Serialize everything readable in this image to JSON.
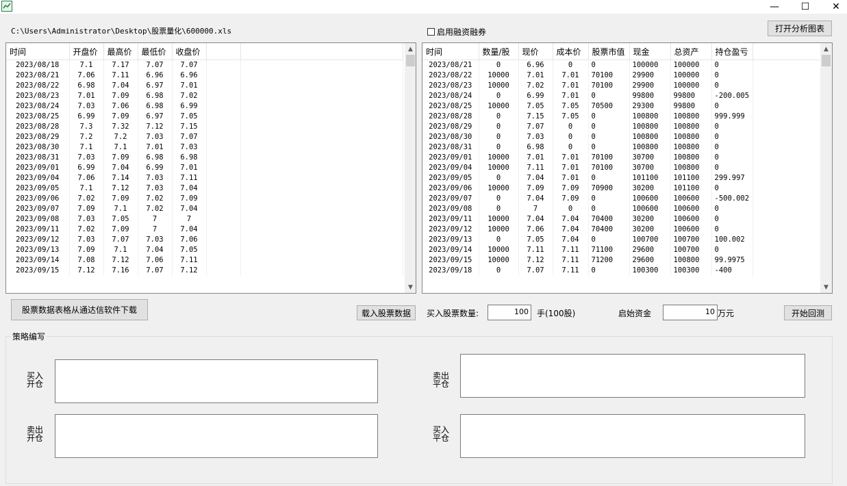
{
  "window": {
    "controls": [
      "—",
      "☐",
      "✕"
    ]
  },
  "file_path": "C:\\Users\\Administrator\\Desktop\\股票量化\\600000.xls",
  "margin_checkbox": {
    "label": "启用融资融券",
    "checked": false
  },
  "open_chart_button": "打开分析图表",
  "price_table": {
    "columns": [
      "时间",
      "开盘价",
      "最高价",
      "最低价",
      "收盘价"
    ],
    "rows": [
      [
        "2023/08/18",
        "7.1",
        "7.17",
        "7.07",
        "7.07"
      ],
      [
        "2023/08/21",
        "7.06",
        "7.11",
        "6.96",
        "6.96"
      ],
      [
        "2023/08/22",
        "6.98",
        "7.04",
        "6.97",
        "7.01"
      ],
      [
        "2023/08/23",
        "7.01",
        "7.09",
        "6.98",
        "7.02"
      ],
      [
        "2023/08/24",
        "7.03",
        "7.06",
        "6.98",
        "6.99"
      ],
      [
        "2023/08/25",
        "6.99",
        "7.09",
        "6.97",
        "7.05"
      ],
      [
        "2023/08/28",
        "7.3",
        "7.32",
        "7.12",
        "7.15"
      ],
      [
        "2023/08/29",
        "7.2",
        "7.2",
        "7.03",
        "7.07"
      ],
      [
        "2023/08/30",
        "7.1",
        "7.1",
        "7.01",
        "7.03"
      ],
      [
        "2023/08/31",
        "7.03",
        "7.09",
        "6.98",
        "6.98"
      ],
      [
        "2023/09/01",
        "6.99",
        "7.04",
        "6.99",
        "7.01"
      ],
      [
        "2023/09/04",
        "7.06",
        "7.14",
        "7.03",
        "7.11"
      ],
      [
        "2023/09/05",
        "7.1",
        "7.12",
        "7.03",
        "7.04"
      ],
      [
        "2023/09/06",
        "7.02",
        "7.09",
        "7.02",
        "7.09"
      ],
      [
        "2023/09/07",
        "7.09",
        "7.1",
        "7.02",
        "7.04"
      ],
      [
        "2023/09/08",
        "7.03",
        "7.05",
        "7",
        "7"
      ],
      [
        "2023/09/11",
        "7.02",
        "7.09",
        "7",
        "7.04"
      ],
      [
        "2023/09/12",
        "7.03",
        "7.07",
        "7.03",
        "7.06"
      ],
      [
        "2023/09/13",
        "7.09",
        "7.1",
        "7.04",
        "7.05"
      ],
      [
        "2023/09/14",
        "7.08",
        "7.12",
        "7.06",
        "7.11"
      ],
      [
        "2023/09/15",
        "7.12",
        "7.16",
        "7.07",
        "7.12"
      ]
    ]
  },
  "backtest_table": {
    "columns": [
      "时间",
      "数量/股",
      "现价",
      "成本价",
      "股票市值",
      "现金",
      "总资产",
      "持仓盈亏"
    ],
    "rows": [
      [
        "2023/08/21",
        "0",
        "6.96",
        "0",
        "0",
        "100000",
        "100000",
        "0"
      ],
      [
        "2023/08/22",
        "10000",
        "7.01",
        "7.01",
        "70100",
        "29900",
        "100000",
        "0"
      ],
      [
        "2023/08/23",
        "10000",
        "7.02",
        "7.01",
        "70100",
        "29900",
        "100000",
        "0"
      ],
      [
        "2023/08/24",
        "0",
        "6.99",
        "7.01",
        "0",
        "99800",
        "99800",
        "-200.005"
      ],
      [
        "2023/08/25",
        "10000",
        "7.05",
        "7.05",
        "70500",
        "29300",
        "99800",
        "0"
      ],
      [
        "2023/08/28",
        "0",
        "7.15",
        "7.05",
        "0",
        "100800",
        "100800",
        "999.999"
      ],
      [
        "2023/08/29",
        "0",
        "7.07",
        "0",
        "0",
        "100800",
        "100800",
        "0"
      ],
      [
        "2023/08/30",
        "0",
        "7.03",
        "0",
        "0",
        "100800",
        "100800",
        "0"
      ],
      [
        "2023/08/31",
        "0",
        "6.98",
        "0",
        "0",
        "100800",
        "100800",
        "0"
      ],
      [
        "2023/09/01",
        "10000",
        "7.01",
        "7.01",
        "70100",
        "30700",
        "100800",
        "0"
      ],
      [
        "2023/09/04",
        "10000",
        "7.11",
        "7.01",
        "70100",
        "30700",
        "100800",
        "0"
      ],
      [
        "2023/09/05",
        "0",
        "7.04",
        "7.01",
        "0",
        "101100",
        "101100",
        "299.997"
      ],
      [
        "2023/09/06",
        "10000",
        "7.09",
        "7.09",
        "70900",
        "30200",
        "101100",
        "0"
      ],
      [
        "2023/09/07",
        "0",
        "7.04",
        "7.09",
        "0",
        "100600",
        "100600",
        "-500.002"
      ],
      [
        "2023/09/08",
        "0",
        "7",
        "0",
        "0",
        "100600",
        "100600",
        "0"
      ],
      [
        "2023/09/11",
        "10000",
        "7.04",
        "7.04",
        "70400",
        "30200",
        "100600",
        "0"
      ],
      [
        "2023/09/12",
        "10000",
        "7.06",
        "7.04",
        "70400",
        "30200",
        "100600",
        "0"
      ],
      [
        "2023/09/13",
        "0",
        "7.05",
        "7.04",
        "0",
        "100700",
        "100700",
        "100.002"
      ],
      [
        "2023/09/14",
        "10000",
        "7.11",
        "7.11",
        "71100",
        "29600",
        "100700",
        "0"
      ],
      [
        "2023/09/15",
        "10000",
        "7.12",
        "7.11",
        "71200",
        "29600",
        "100800",
        "99.9975"
      ],
      [
        "2023/09/18",
        "0",
        "7.07",
        "7.11",
        "0",
        "100300",
        "100300",
        "-400"
      ]
    ]
  },
  "download_button": "股票数据表格从通达信软件下载",
  "load_button": "载入股票数据",
  "buy_qty": {
    "label": "买入股票数量:",
    "value": "100",
    "unit": "手(100股)"
  },
  "capital": {
    "label": "启始资金",
    "value": "10",
    "unit": "万元"
  },
  "start_backtest_button": "开始回测",
  "strategy": {
    "group_label": "策略编写",
    "buy_open": [
      "买入",
      "开仓"
    ],
    "sell_close": [
      "卖出",
      "平仓"
    ],
    "sell_open": [
      "卖出",
      "开仓"
    ],
    "buy_close": [
      "买入",
      "平仓"
    ]
  },
  "icons": {
    "scroll_up": "▲",
    "scroll_down": "▼"
  }
}
